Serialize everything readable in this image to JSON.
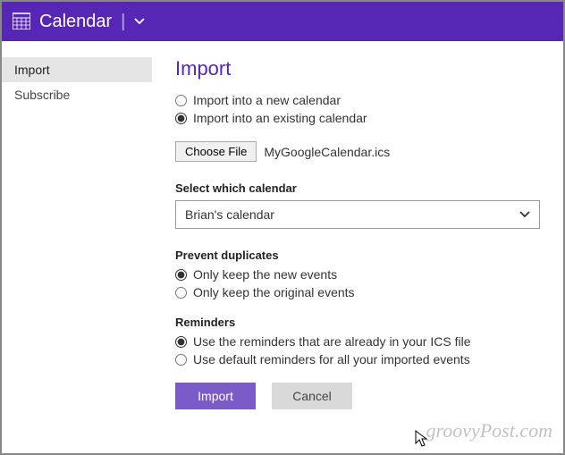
{
  "header": {
    "title": "Calendar"
  },
  "sidebar": {
    "items": [
      {
        "label": "Import",
        "active": true
      },
      {
        "label": "Subscribe",
        "active": false
      }
    ]
  },
  "main": {
    "title": "Import",
    "dest": {
      "opt_new": "Import into a new calendar",
      "opt_existing": "Import into an existing calendar",
      "selected": "existing"
    },
    "file": {
      "button": "Choose File",
      "name": "MyGoogleCalendar.ics"
    },
    "calendar_select": {
      "label": "Select which calendar",
      "value": "Brian's calendar"
    },
    "duplicates": {
      "label": "Prevent duplicates",
      "opt_new": "Only keep the new events",
      "opt_orig": "Only keep the original events",
      "selected": "new"
    },
    "reminders": {
      "label": "Reminders",
      "opt_ics": "Use the reminders that are already in your ICS file",
      "opt_default": "Use default reminders for all your imported events",
      "selected": "ics"
    },
    "buttons": {
      "import": "Import",
      "cancel": "Cancel"
    }
  },
  "watermark": "groovyPost.com"
}
